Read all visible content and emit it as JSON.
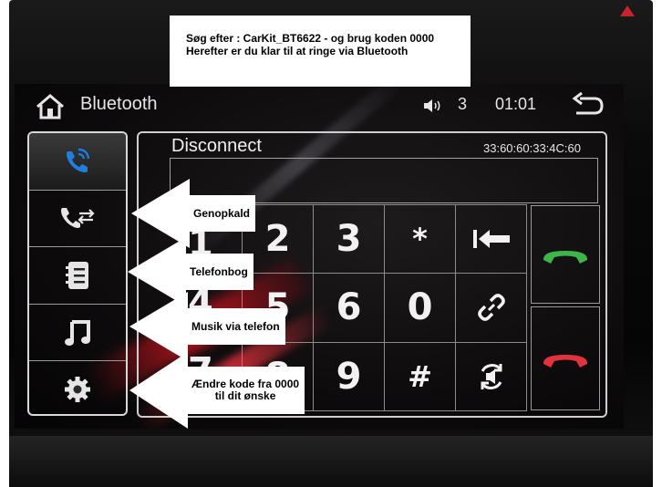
{
  "banner": {
    "line1": "Søg efter : CarKit_BT6622 - og brug koden 0000",
    "line2": "Herefter er du klar til at ringe via Bluetooth"
  },
  "header": {
    "title": "Bluetooth",
    "volume_value": "3",
    "clock": "01:01",
    "icons": [
      "home-icon",
      "volume-icon",
      "back-icon"
    ]
  },
  "sidebar": {
    "items": [
      {
        "name": "bluetooth-call",
        "icon": "phone-bluetooth-icon",
        "active": true
      },
      {
        "name": "call-log",
        "icon": "phone-transfer-icon",
        "active": false
      },
      {
        "name": "phonebook",
        "icon": "contacts-icon",
        "active": false
      },
      {
        "name": "music",
        "icon": "music-note-icon",
        "active": false
      },
      {
        "name": "settings",
        "icon": "gear-icon",
        "active": false
      }
    ]
  },
  "main": {
    "status": "Disconnect",
    "device_address": "33:60:60:33:4C:60",
    "keypad": [
      [
        "2",
        "3",
        "*",
        "backspace-icon"
      ],
      [
        "5",
        "6",
        "0",
        "link-icon"
      ],
      [
        "8",
        "9",
        "#",
        "switch-audio-icon"
      ]
    ],
    "keypad_left": [
      "1",
      "4",
      "7"
    ],
    "answer_icon": "answer-call-icon",
    "hangup_icon": "hangup-call-icon",
    "colors": {
      "accent_blue": "#1f7fe0",
      "answer_green": "#3db54a",
      "hangup_red": "#e0333c"
    }
  },
  "callouts": [
    {
      "label": "Genopkald"
    },
    {
      "label": "Telefonbog"
    },
    {
      "label": "Musik via telefon"
    },
    {
      "line1": "Ændre kode fra 0000",
      "line2": "til dit ønske"
    }
  ]
}
